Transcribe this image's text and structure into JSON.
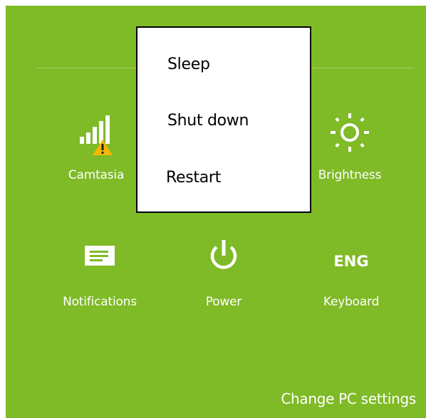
{
  "colors": {
    "panel_background": "#7fba27",
    "divider": "#a4cf63",
    "menu_background": "#ffffff",
    "menu_border": "#000000",
    "warning": "#f5b800"
  },
  "power_menu": {
    "items": [
      {
        "label": "Sleep"
      },
      {
        "label": "Shut down"
      },
      {
        "label": "Restart"
      }
    ]
  },
  "tiles": {
    "network": {
      "label": "Camtasia",
      "icon": "signal-bars-warning-icon"
    },
    "brightness": {
      "label": "Brightness",
      "icon": "sun-icon"
    },
    "notifications": {
      "label": "Notifications",
      "icon": "message-icon"
    },
    "power": {
      "label": "Power",
      "icon": "power-icon"
    },
    "keyboard": {
      "label": "Keyboard",
      "icon_text": "ENG"
    }
  },
  "footer": {
    "change_pc_settings": "Change PC settings"
  }
}
